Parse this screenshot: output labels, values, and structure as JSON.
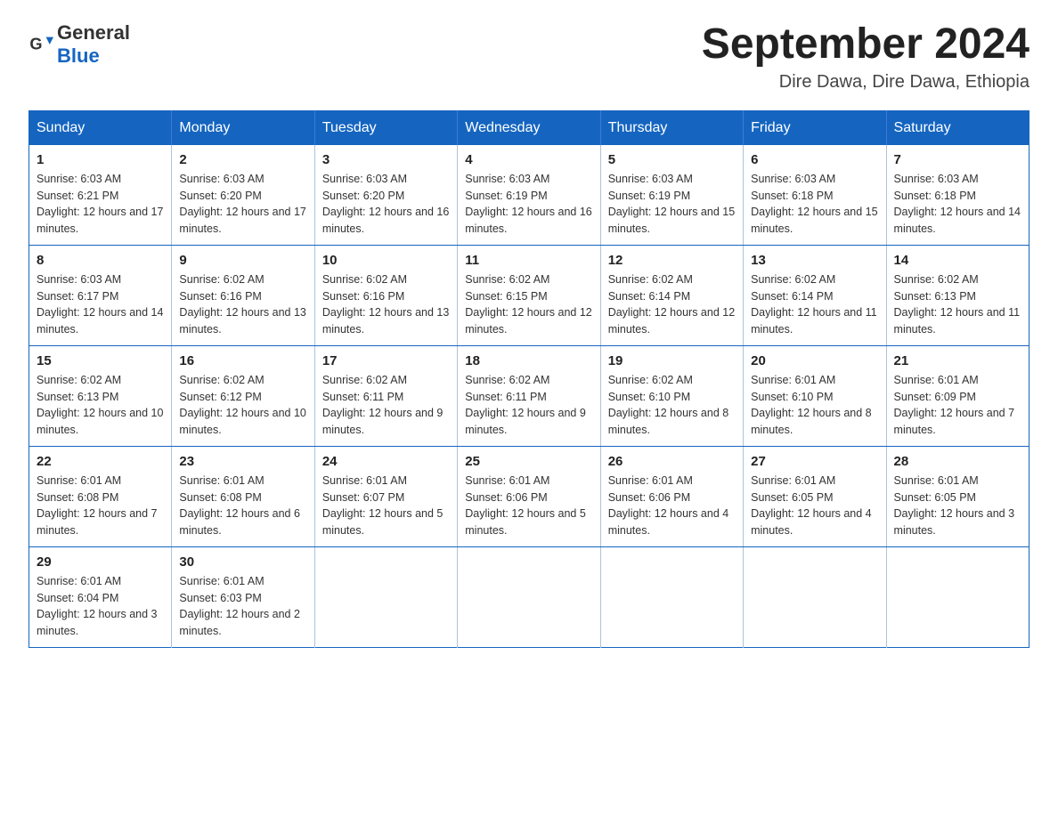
{
  "logo": {
    "text_general": "General",
    "text_blue": "Blue"
  },
  "header": {
    "month_year": "September 2024",
    "location": "Dire Dawa, Dire Dawa, Ethiopia"
  },
  "weekdays": [
    "Sunday",
    "Monday",
    "Tuesday",
    "Wednesday",
    "Thursday",
    "Friday",
    "Saturday"
  ],
  "weeks": [
    [
      {
        "day": "1",
        "sunrise": "Sunrise: 6:03 AM",
        "sunset": "Sunset: 6:21 PM",
        "daylight": "Daylight: 12 hours and 17 minutes."
      },
      {
        "day": "2",
        "sunrise": "Sunrise: 6:03 AM",
        "sunset": "Sunset: 6:20 PM",
        "daylight": "Daylight: 12 hours and 17 minutes."
      },
      {
        "day": "3",
        "sunrise": "Sunrise: 6:03 AM",
        "sunset": "Sunset: 6:20 PM",
        "daylight": "Daylight: 12 hours and 16 minutes."
      },
      {
        "day": "4",
        "sunrise": "Sunrise: 6:03 AM",
        "sunset": "Sunset: 6:19 PM",
        "daylight": "Daylight: 12 hours and 16 minutes."
      },
      {
        "day": "5",
        "sunrise": "Sunrise: 6:03 AM",
        "sunset": "Sunset: 6:19 PM",
        "daylight": "Daylight: 12 hours and 15 minutes."
      },
      {
        "day": "6",
        "sunrise": "Sunrise: 6:03 AM",
        "sunset": "Sunset: 6:18 PM",
        "daylight": "Daylight: 12 hours and 15 minutes."
      },
      {
        "day": "7",
        "sunrise": "Sunrise: 6:03 AM",
        "sunset": "Sunset: 6:18 PM",
        "daylight": "Daylight: 12 hours and 14 minutes."
      }
    ],
    [
      {
        "day": "8",
        "sunrise": "Sunrise: 6:03 AM",
        "sunset": "Sunset: 6:17 PM",
        "daylight": "Daylight: 12 hours and 14 minutes."
      },
      {
        "day": "9",
        "sunrise": "Sunrise: 6:02 AM",
        "sunset": "Sunset: 6:16 PM",
        "daylight": "Daylight: 12 hours and 13 minutes."
      },
      {
        "day": "10",
        "sunrise": "Sunrise: 6:02 AM",
        "sunset": "Sunset: 6:16 PM",
        "daylight": "Daylight: 12 hours and 13 minutes."
      },
      {
        "day": "11",
        "sunrise": "Sunrise: 6:02 AM",
        "sunset": "Sunset: 6:15 PM",
        "daylight": "Daylight: 12 hours and 12 minutes."
      },
      {
        "day": "12",
        "sunrise": "Sunrise: 6:02 AM",
        "sunset": "Sunset: 6:14 PM",
        "daylight": "Daylight: 12 hours and 12 minutes."
      },
      {
        "day": "13",
        "sunrise": "Sunrise: 6:02 AM",
        "sunset": "Sunset: 6:14 PM",
        "daylight": "Daylight: 12 hours and 11 minutes."
      },
      {
        "day": "14",
        "sunrise": "Sunrise: 6:02 AM",
        "sunset": "Sunset: 6:13 PM",
        "daylight": "Daylight: 12 hours and 11 minutes."
      }
    ],
    [
      {
        "day": "15",
        "sunrise": "Sunrise: 6:02 AM",
        "sunset": "Sunset: 6:13 PM",
        "daylight": "Daylight: 12 hours and 10 minutes."
      },
      {
        "day": "16",
        "sunrise": "Sunrise: 6:02 AM",
        "sunset": "Sunset: 6:12 PM",
        "daylight": "Daylight: 12 hours and 10 minutes."
      },
      {
        "day": "17",
        "sunrise": "Sunrise: 6:02 AM",
        "sunset": "Sunset: 6:11 PM",
        "daylight": "Daylight: 12 hours and 9 minutes."
      },
      {
        "day": "18",
        "sunrise": "Sunrise: 6:02 AM",
        "sunset": "Sunset: 6:11 PM",
        "daylight": "Daylight: 12 hours and 9 minutes."
      },
      {
        "day": "19",
        "sunrise": "Sunrise: 6:02 AM",
        "sunset": "Sunset: 6:10 PM",
        "daylight": "Daylight: 12 hours and 8 minutes."
      },
      {
        "day": "20",
        "sunrise": "Sunrise: 6:01 AM",
        "sunset": "Sunset: 6:10 PM",
        "daylight": "Daylight: 12 hours and 8 minutes."
      },
      {
        "day": "21",
        "sunrise": "Sunrise: 6:01 AM",
        "sunset": "Sunset: 6:09 PM",
        "daylight": "Daylight: 12 hours and 7 minutes."
      }
    ],
    [
      {
        "day": "22",
        "sunrise": "Sunrise: 6:01 AM",
        "sunset": "Sunset: 6:08 PM",
        "daylight": "Daylight: 12 hours and 7 minutes."
      },
      {
        "day": "23",
        "sunrise": "Sunrise: 6:01 AM",
        "sunset": "Sunset: 6:08 PM",
        "daylight": "Daylight: 12 hours and 6 minutes."
      },
      {
        "day": "24",
        "sunrise": "Sunrise: 6:01 AM",
        "sunset": "Sunset: 6:07 PM",
        "daylight": "Daylight: 12 hours and 5 minutes."
      },
      {
        "day": "25",
        "sunrise": "Sunrise: 6:01 AM",
        "sunset": "Sunset: 6:06 PM",
        "daylight": "Daylight: 12 hours and 5 minutes."
      },
      {
        "day": "26",
        "sunrise": "Sunrise: 6:01 AM",
        "sunset": "Sunset: 6:06 PM",
        "daylight": "Daylight: 12 hours and 4 minutes."
      },
      {
        "day": "27",
        "sunrise": "Sunrise: 6:01 AM",
        "sunset": "Sunset: 6:05 PM",
        "daylight": "Daylight: 12 hours and 4 minutes."
      },
      {
        "day": "28",
        "sunrise": "Sunrise: 6:01 AM",
        "sunset": "Sunset: 6:05 PM",
        "daylight": "Daylight: 12 hours and 3 minutes."
      }
    ],
    [
      {
        "day": "29",
        "sunrise": "Sunrise: 6:01 AM",
        "sunset": "Sunset: 6:04 PM",
        "daylight": "Daylight: 12 hours and 3 minutes."
      },
      {
        "day": "30",
        "sunrise": "Sunrise: 6:01 AM",
        "sunset": "Sunset: 6:03 PM",
        "daylight": "Daylight: 12 hours and 2 minutes."
      },
      null,
      null,
      null,
      null,
      null
    ]
  ]
}
